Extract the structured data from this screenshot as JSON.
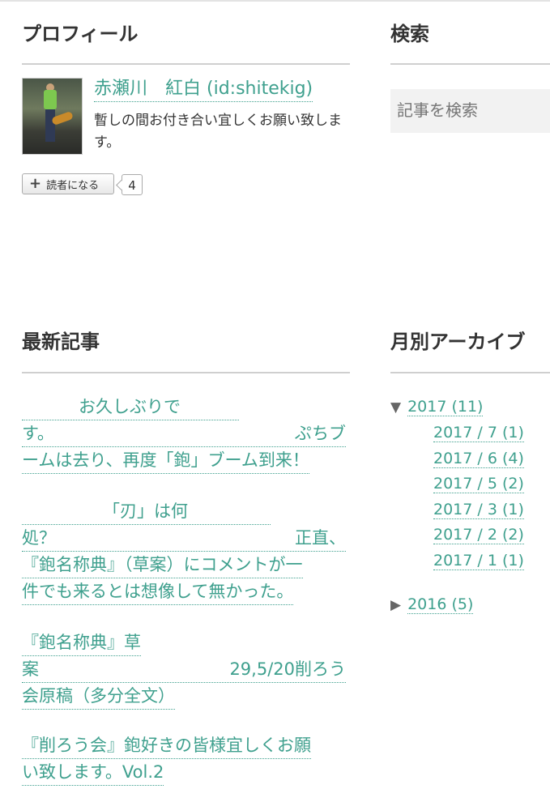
{
  "profile": {
    "title": "プロフィール",
    "name": "赤瀬川　紅白 (id:shitekig)",
    "description": "暫しの間お付き合い宜しくお願い致します。",
    "reader_button_label": "読者になる",
    "reader_count": "4"
  },
  "search": {
    "title": "検索",
    "placeholder": "記事を検索"
  },
  "recent": {
    "title": "最新記事",
    "entries": [
      {
        "lines": [
          "お久しぶりで",
          "す。|ぷちブ",
          "ームは去り、再度「鉋」ブーム到来！"
        ]
      },
      {
        "lines": [
          "「刃」は何",
          "処？|正直、",
          "『鉋名称典』（草案）にコメントが一",
          "件でも来るとは想像して無かった。"
        ]
      },
      {
        "lines": [
          "『鉋名称典』草",
          "案|29,5/20削ろう",
          "会原稿（多分全文）"
        ]
      },
      {
        "lines": [
          "『削ろう会』鉋好きの皆様宜しくお願",
          "い致します。Vol.2"
        ]
      }
    ]
  },
  "archive": {
    "title": "月別アーカイブ",
    "years": [
      {
        "label": "2017 (11)",
        "expanded": true,
        "months": [
          "2017 / 7 (1)",
          "2017 / 6 (4)",
          "2017 / 5 (2)",
          "2017 / 3 (1)",
          "2017 / 2 (2)",
          "2017 / 1 (1)"
        ]
      },
      {
        "label": "2016 (5)",
        "expanded": false
      }
    ]
  },
  "icons": {
    "expanded": "triangle-down-icon",
    "collapsed": "triangle-right-icon",
    "plus": "plus-icon"
  },
  "colors": {
    "link": "#3fa08e",
    "rule": "#cfcfcf",
    "search_bg": "#f2f2f2"
  }
}
